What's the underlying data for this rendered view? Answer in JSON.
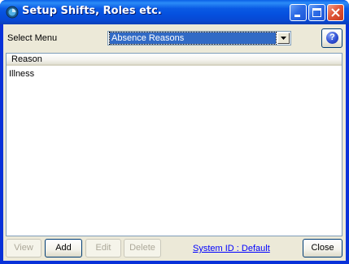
{
  "window": {
    "title": "Setup Shifts, Roles etc."
  },
  "toolbar": {
    "select_label": "Select Menu",
    "select_value": "Absence Reasons",
    "help_glyph": "?"
  },
  "list": {
    "columns": [
      "Reason"
    ],
    "rows": [
      "Illness"
    ]
  },
  "footer": {
    "view_label": "View",
    "add_label": "Add",
    "edit_label": "Edit",
    "delete_label": "Delete",
    "system_id_link": "System ID : Default",
    "close_label": "Close"
  },
  "icons": {
    "app": "app-icon",
    "minimize": "minimize-icon",
    "maximize": "maximize-icon",
    "close": "close-icon",
    "dropdown": "chevron-down-icon",
    "help": "help-icon"
  },
  "colors": {
    "titlebar": "#0a5ae4",
    "face": "#ece9d8",
    "selection": "#316ac5",
    "link": "#0000ff",
    "close_button": "#e0573a"
  }
}
